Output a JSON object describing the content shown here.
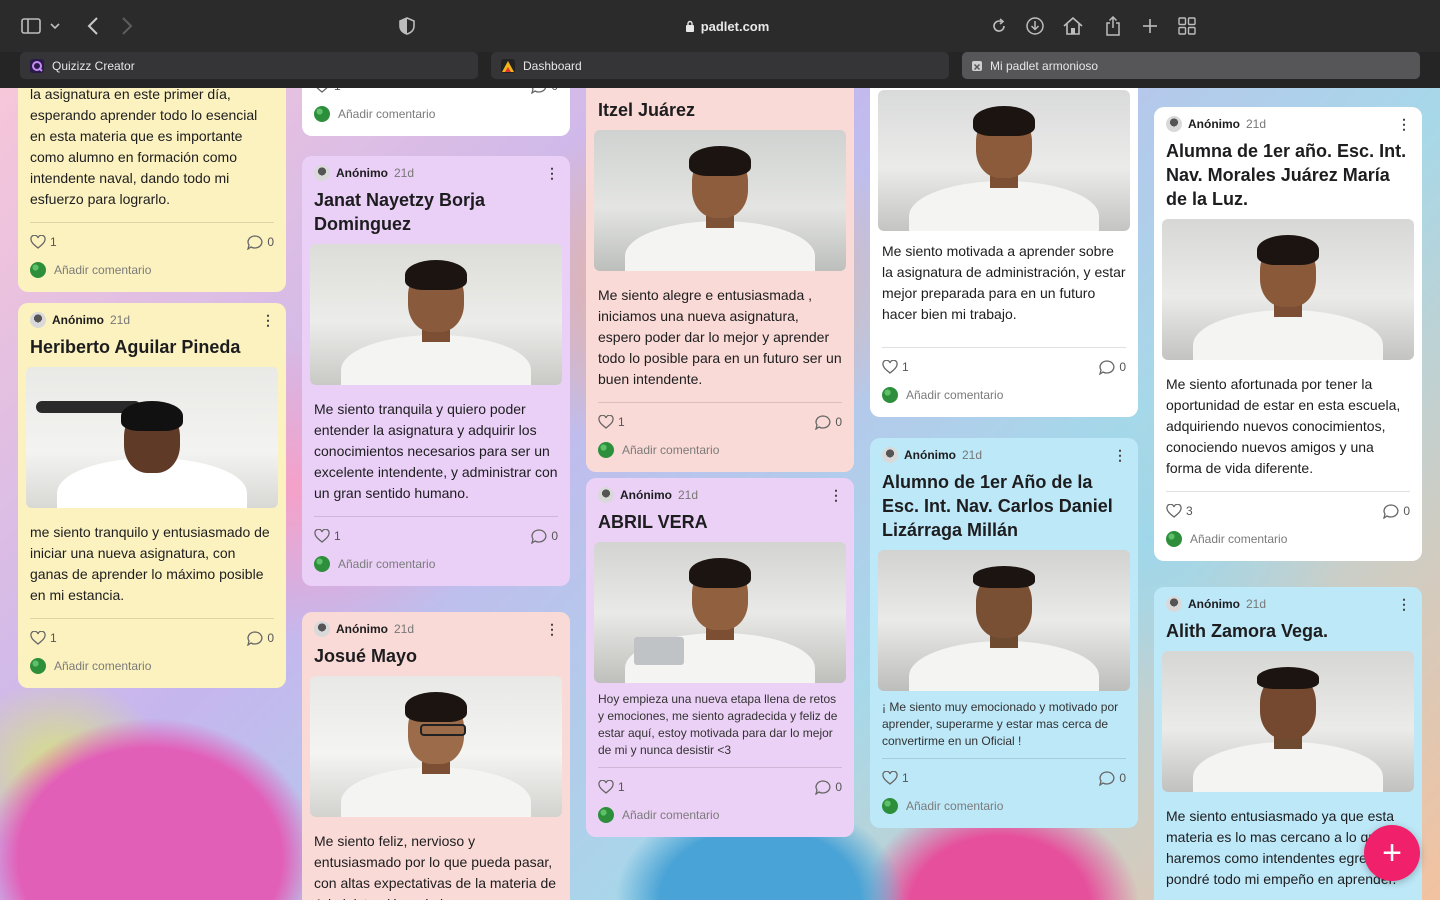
{
  "browser": {
    "url": "padlet.com",
    "tabs": [
      {
        "label": "Quizizz Creator",
        "active": false,
        "icon": "quizizz-icon"
      },
      {
        "label": "Dashboard",
        "active": false,
        "icon": "dashboard-app-icon"
      },
      {
        "label": "Mi padlet armonioso",
        "active": true,
        "icon": "padlet-icon"
      }
    ]
  },
  "colors": {
    "yellow": "#fcf2bf",
    "purple": "#ead0f7",
    "pink": "#fadad6",
    "white": "#ffffff",
    "blue": "#bde8f8",
    "fab": "#f0206a"
  },
  "posts": {
    "c1a": {
      "body": "la asignatura en este primer día, esperando aprender todo lo esencial en esta materia que es importante como alumno en formación como intendente naval, dando todo mi esfuerzo para lograrlo.",
      "likes": "1",
      "comments": "0",
      "add_comment": "Añadir comentario"
    },
    "c1b": {
      "author": "Anónimo",
      "age": "21d",
      "title": "Heriberto Aguilar Pineda",
      "body": "me siento tranquilo y entusiasmado de iniciar una nueva asignatura, con ganas de aprender lo máximo posible en mi estancia.",
      "likes": "1",
      "comments": "0",
      "add_comment": "Añadir comentario"
    },
    "c2a": {
      "likes": "1",
      "comments": "0",
      "add_comment": "Añadir comentario"
    },
    "c2b": {
      "author": "Anónimo",
      "age": "21d",
      "title": "Janat Nayetzy Borja Dominguez",
      "body": " Me siento tranquila y quiero poder entender la asignatura y adquirir los conocimientos necesarios para ser un excelente intendente, y administrar con un gran sentido humano.",
      "likes": "1",
      "comments": "0",
      "add_comment": "Añadir comentario"
    },
    "c2c": {
      "author": "Anónimo",
      "age": "21d",
      "title": "Josué Mayo",
      "body": "Me siento feliz, nervioso y entusiasmado por lo que pueda pasar, con altas expectativas de la materia de Administración y de la"
    },
    "c3a": {
      "title": "Itzel Juárez",
      "body": "Me siento alegre e entusiasmada , iniciamos una nueva asignatura, espero poder dar lo mejor y aprender todo lo posible para en un futuro ser un buen intendente.",
      "likes": "1",
      "comments": "0",
      "add_comment": "Añadir comentario"
    },
    "c3b": {
      "author": "Anónimo",
      "age": "21d",
      "title": "ABRIL VERA",
      "body": "Hoy empieza una nueva etapa llena de retos y emociones, me siento agradecida y feliz de estar aquí, estoy motivada para dar lo mejor de mi y nunca desistir <3",
      "likes": "1",
      "comments": "0",
      "add_comment": "Añadir comentario"
    },
    "c4a": {
      "body": "Me siento motivada a aprender sobre la asignatura de administración, y estar mejor preparada para en un futuro hacer bien mi trabajo.",
      "likes": "1",
      "comments": "0",
      "add_comment": "Añadir comentario"
    },
    "c4b": {
      "author": "Anónimo",
      "age": "21d",
      "title": "Alumno de 1er Año de la Esc. Int. Nav. Carlos Daniel Lizárraga Millán",
      "body": "¡ Me siento muy emocionado y motivado por aprender, superarme y estar mas cerca de convertirme en un Oficial !",
      "likes": "1",
      "comments": "0",
      "add_comment": "Añadir comentario"
    },
    "c5a": {
      "author": "Anónimo",
      "age": "21d",
      "title": "Alumna de 1er año. Esc. Int. Nav. Morales Juárez María de la Luz.",
      "body": "Me siento afortunada por tener la oportunidad de estar en esta escuela, adquiriendo nuevos conocimientos, conociendo nuevos amigos y una forma de vida diferente.",
      "likes": "3",
      "comments": "0",
      "add_comment": "Añadir comentario"
    },
    "c5b": {
      "author": "Anónimo",
      "age": "21d",
      "title": "Alith Zamora Vega.",
      "body": "Me siento entusiasmado ya que esta materia es lo mas cercano a lo que haremos como intendentes egresados, pondré todo mi empeño en aprender."
    }
  },
  "fab": {
    "label": "+"
  }
}
